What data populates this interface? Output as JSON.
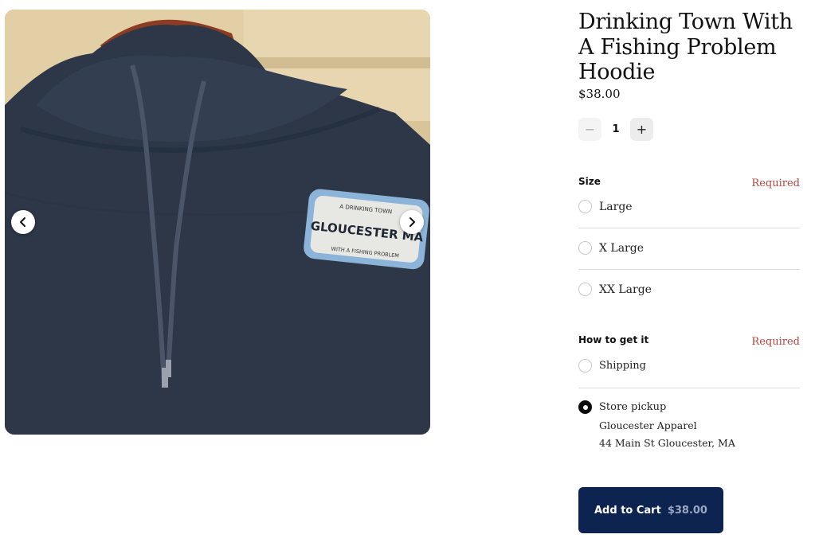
{
  "product": {
    "title": "Drinking Town With A Fishing Problem Hoodie",
    "price": "$38.00",
    "image_patch": {
      "top_text": "A DRINKING TOWN",
      "main_text": "GLOUCESTER MA",
      "bottom_text": "WITH A FISHING PROBLEM"
    }
  },
  "gallery": {
    "prev_icon": "chevron-left-icon",
    "next_icon": "chevron-right-icon"
  },
  "quantity": {
    "decrease_symbol": "−",
    "value": "1",
    "increase_symbol": "+"
  },
  "size": {
    "label": "Size",
    "required": "Required",
    "options": [
      "Large",
      "X Large",
      "XX Large"
    ]
  },
  "fulfillment": {
    "label": "How to get it",
    "required": "Required",
    "shipping_label": "Shipping",
    "pickup_label": "Store pickup",
    "pickup_store": "Gloucester Apparel",
    "pickup_address": "44 Main St Gloucester, MA",
    "selected": "Store pickup"
  },
  "cart": {
    "label": "Add to Cart",
    "price": "$38.00"
  },
  "colors": {
    "accent": "#0e2450",
    "required": "#b3463c"
  }
}
